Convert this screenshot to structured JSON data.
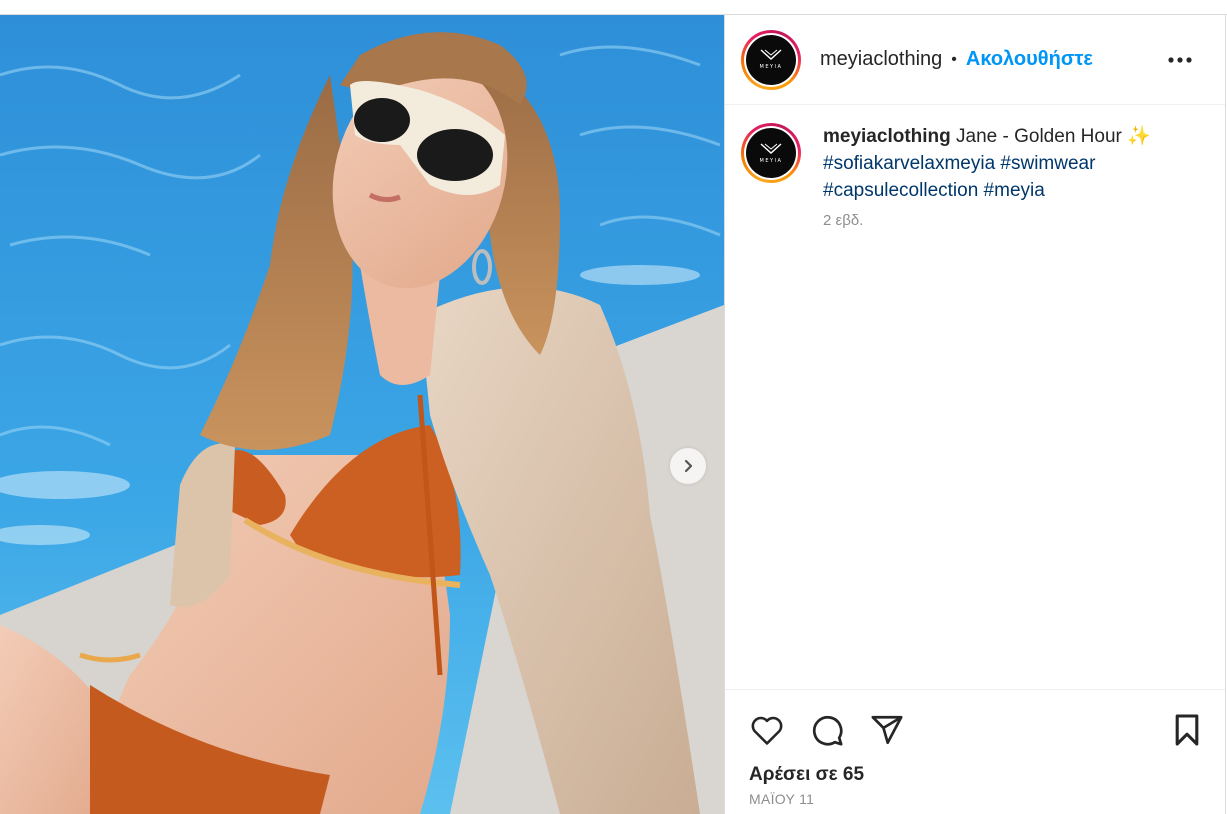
{
  "post": {
    "username": "meyiaclothing",
    "logo_text": "MEYIA",
    "follow_label": "Ακολουθήστε",
    "separator": "•",
    "caption": {
      "username": "meyiaclothing",
      "text": "Jane - Golden Hour ✨",
      "hashtags": [
        "#sofiakarvelaxmeyia",
        "#swimwear",
        "#capsulecollection",
        "#meyia"
      ],
      "time_ago": "2 εβδ."
    },
    "likes": "Αρέσει σε 65",
    "date": "ΜΑΪΟΥ 11"
  },
  "icons": {
    "more": "more-options-icon",
    "like": "heart-icon",
    "comment": "comment-icon",
    "share": "send-icon",
    "save": "bookmark-icon",
    "next": "chevron-right-icon"
  },
  "colors": {
    "link_blue": "#0095f6",
    "hashtag": "#00376b",
    "muted": "#8e8e8e",
    "text": "#262626"
  }
}
